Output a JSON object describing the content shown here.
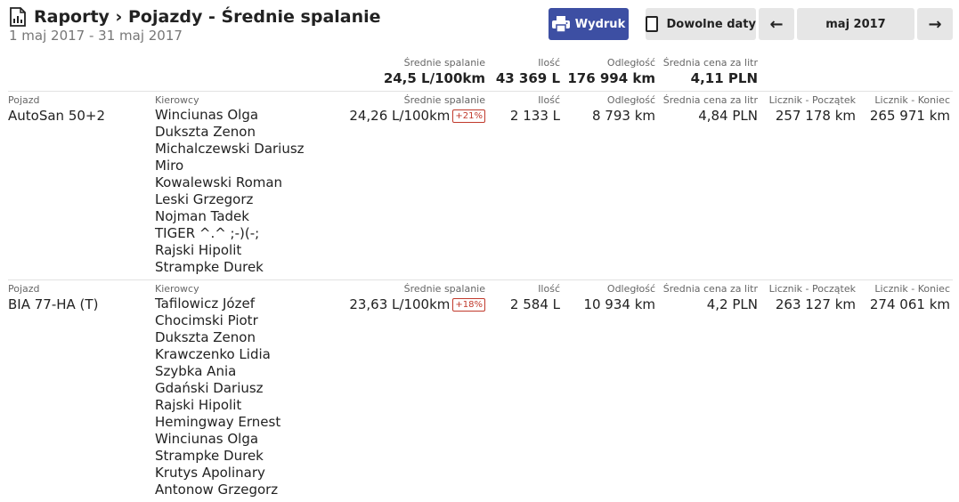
{
  "header": {
    "title": "Raporty › Pojazdy - Średnie spalanie",
    "date_range": "1 maj 2017 - 31 maj 2017"
  },
  "toolbar": {
    "print_label": "Wydruk",
    "custom_dates_label": "Dowolne daty",
    "prev_label": "←",
    "month_label": "maj 2017",
    "next_label": "→"
  },
  "summary": {
    "avg_consumption_label": "Średnie spalanie",
    "avg_consumption": "24,5 L/100km",
    "amount_label": "Ilość",
    "amount": "43 369 L",
    "distance_label": "Odległość",
    "distance": "176 994 km",
    "avg_price_label": "Średnia cena za litr",
    "avg_price": "4,11 PLN"
  },
  "columns": {
    "vehicle": "Pojazd",
    "drivers": "Kierowcy",
    "avg_consumption": "Średnie spalanie",
    "amount": "Ilość",
    "distance": "Odległość",
    "avg_price": "Średnia cena za litr",
    "counter_start": "Licznik - Początek",
    "counter_end": "Licznik - Koniec"
  },
  "vehicles": [
    {
      "name": "AutoSan 50+2",
      "drivers": [
        "Winciunas Olga",
        "Dukszta Zenon",
        "Michalczewski Dariusz",
        "Miro",
        "Kowalewski Roman",
        "Leski Grzegorz",
        "Nojman Tadek",
        "TIGER ^.^ ;-)(-;",
        "Rajski Hipolit",
        "Strampke Durek"
      ],
      "avg_consumption": "24,26 L/100km",
      "deviation": "+21%",
      "amount": "2 133 L",
      "distance": "8 793 km",
      "avg_price": "4,84 PLN",
      "counter_start": "257 178 km",
      "counter_end": "265 971 km"
    },
    {
      "name": "BIA 77-HA (T)",
      "drivers": [
        "Tafilowicz Józef",
        "Chocimski Piotr",
        "Dukszta Zenon",
        "Krawczenko Lidia",
        "Szybka Ania",
        "Gdański Dariusz",
        "Rajski Hipolit",
        "Hemingway Ernest",
        "Winciunas Olga",
        "Strampke Durek",
        "Krutys Apolinary",
        "Antonow Grzegorz"
      ],
      "avg_consumption": "23,63 L/100km",
      "deviation": "+18%",
      "amount": "2 584 L",
      "distance": "10 934 km",
      "avg_price": "4,2 PLN",
      "counter_start": "263 127 km",
      "counter_end": "274 061 km"
    }
  ]
}
